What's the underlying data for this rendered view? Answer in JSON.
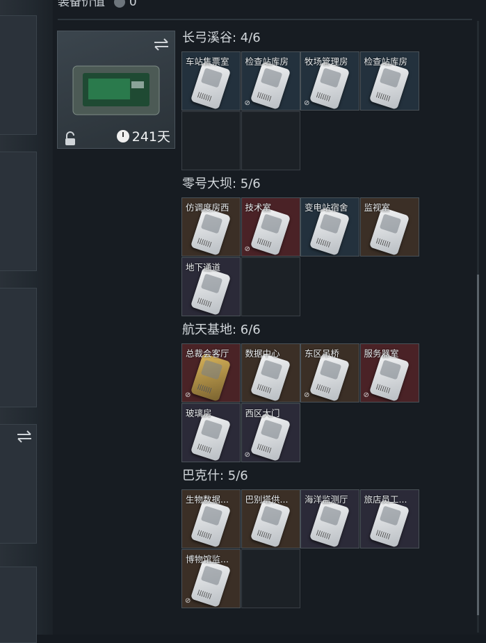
{
  "header": {
    "title": "装备价值",
    "value": "0"
  },
  "container": {
    "days": "241天",
    "icons": {
      "swap": "swap-arrows-icon",
      "lock": "unlock-icon",
      "clock": "clock-icon"
    }
  },
  "sections": [
    {
      "title": "长弓溪谷: 4/6",
      "cards": [
        {
          "label": "车站售票室",
          "color": "blue",
          "nodrop": false
        },
        {
          "label": "检查站库房",
          "color": "blue",
          "nodrop": true
        },
        {
          "label": "牧场管理房",
          "color": "blue",
          "nodrop": true
        },
        {
          "label": "检查站库房",
          "color": "blue",
          "nodrop": false
        }
      ]
    },
    {
      "title": "零号大坝: 5/6",
      "cards": [
        {
          "label": "仿调度房西",
          "color": "brown",
          "nodrop": false
        },
        {
          "label": "技术室",
          "color": "red",
          "nodrop": true
        },
        {
          "label": "变电站宿舍",
          "color": "blue",
          "nodrop": false
        },
        {
          "label": "监视室",
          "color": "brown",
          "nodrop": false
        },
        {
          "label": "地下通道",
          "color": "purple",
          "nodrop": false
        }
      ]
    },
    {
      "title": "航天基地: 6/6",
      "cards": [
        {
          "label": "总裁会客厅",
          "color": "gold",
          "nodrop": true
        },
        {
          "label": "数据中心",
          "color": "brown",
          "nodrop": false
        },
        {
          "label": "东区吊桥",
          "color": "brown",
          "nodrop": true
        },
        {
          "label": "服务器室",
          "color": "red",
          "nodrop": true
        },
        {
          "label": "玻璃房",
          "color": "purple",
          "nodrop": false
        },
        {
          "label": "西区大门",
          "color": "purple",
          "nodrop": true
        }
      ]
    },
    {
      "title": "巴克什: 5/6",
      "cards": [
        {
          "label": "生物数据...",
          "color": "brown",
          "nodrop": false
        },
        {
          "label": "巴别塔供...",
          "color": "brown",
          "nodrop": false
        },
        {
          "label": "海洋监测厅",
          "color": "purple",
          "nodrop": false
        },
        {
          "label": "旅店员工...",
          "color": "purple",
          "nodrop": false
        },
        {
          "label": "博物馆监...",
          "color": "brown",
          "nodrop": true
        }
      ]
    }
  ]
}
